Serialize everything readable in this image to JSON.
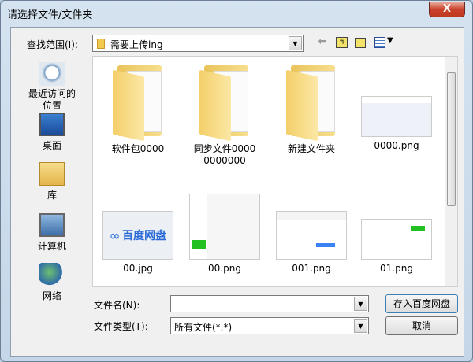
{
  "window": {
    "title": "请选择文件/文件夹",
    "close_label": "X"
  },
  "lookin": {
    "label": "查找范围(I):",
    "value": "需要上传ing"
  },
  "toolbar": {
    "back": "back-icon",
    "up": "up-folder-icon",
    "new_folder": "new-folder-icon",
    "view_menu": "view-menu-icon"
  },
  "places": [
    {
      "label": "最近访问的位置",
      "icon": "recent-icon"
    },
    {
      "label": "桌面",
      "icon": "desktop-icon"
    },
    {
      "label": "库",
      "icon": "library-icon"
    },
    {
      "label": "计算机",
      "icon": "computer-icon"
    },
    {
      "label": "网络",
      "icon": "network-icon"
    }
  ],
  "files": [
    {
      "name": "软件包0000",
      "type": "folder"
    },
    {
      "name": "同步文件00000000000",
      "type": "folder"
    },
    {
      "name": "新建文件夹",
      "type": "folder"
    },
    {
      "name": "0000.png",
      "type": "image"
    },
    {
      "name": "00.jpg",
      "type": "image",
      "thumb_text": "百度网盘"
    },
    {
      "name": "00.png",
      "type": "image"
    },
    {
      "name": "001.png",
      "type": "image"
    },
    {
      "name": "01.png",
      "type": "image"
    }
  ],
  "filename": {
    "label": "文件名(N):",
    "value": ""
  },
  "filetype": {
    "label": "文件类型(T):",
    "value": "所有文件(*.*)"
  },
  "buttons": {
    "save": "存入百度网盘",
    "cancel": "取消"
  }
}
